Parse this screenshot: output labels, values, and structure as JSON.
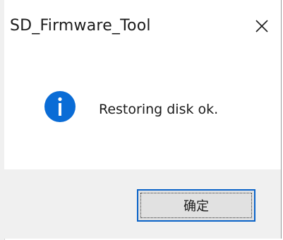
{
  "window": {
    "title": "SD_Firmware_Tool"
  },
  "titlebar": {
    "close_icon": "close-icon"
  },
  "dialog": {
    "icon": "info-icon",
    "message": "Restoring disk ok."
  },
  "buttons": {
    "ok_label": "确定"
  },
  "colors": {
    "info_blue": "#0a6cd6",
    "footer_bg": "#f0f0f0",
    "button_border": "#0a63c8"
  }
}
